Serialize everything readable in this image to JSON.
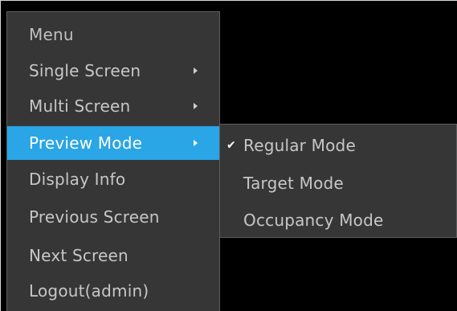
{
  "context_menu": {
    "items": [
      {
        "label": "Menu",
        "has_submenu": false
      },
      {
        "label": "Single Screen",
        "has_submenu": true
      },
      {
        "label": "Multi Screen",
        "has_submenu": true
      },
      {
        "label": "Preview Mode",
        "has_submenu": true,
        "highlighted": true
      },
      {
        "label": "Display Info",
        "has_submenu": false
      },
      {
        "label": "Previous Screen",
        "has_submenu": false
      },
      {
        "label": "Next Screen",
        "has_submenu": false
      },
      {
        "label": "Logout(admin)",
        "has_submenu": false
      }
    ]
  },
  "preview_mode_submenu": {
    "items": [
      {
        "label": "Regular Mode",
        "checked": true
      },
      {
        "label": "Target Mode",
        "checked": false
      },
      {
        "label": "Occupancy Mode",
        "checked": false
      }
    ],
    "check_glyph": "✔"
  },
  "colors": {
    "menu_bg": "#363636",
    "highlight": "#2aa5e6",
    "text": "#c7c7c7",
    "screen_bg": "#000000"
  },
  "icons": {
    "submenu_arrow": "chevron-right-icon",
    "checkmark": "check-icon"
  }
}
